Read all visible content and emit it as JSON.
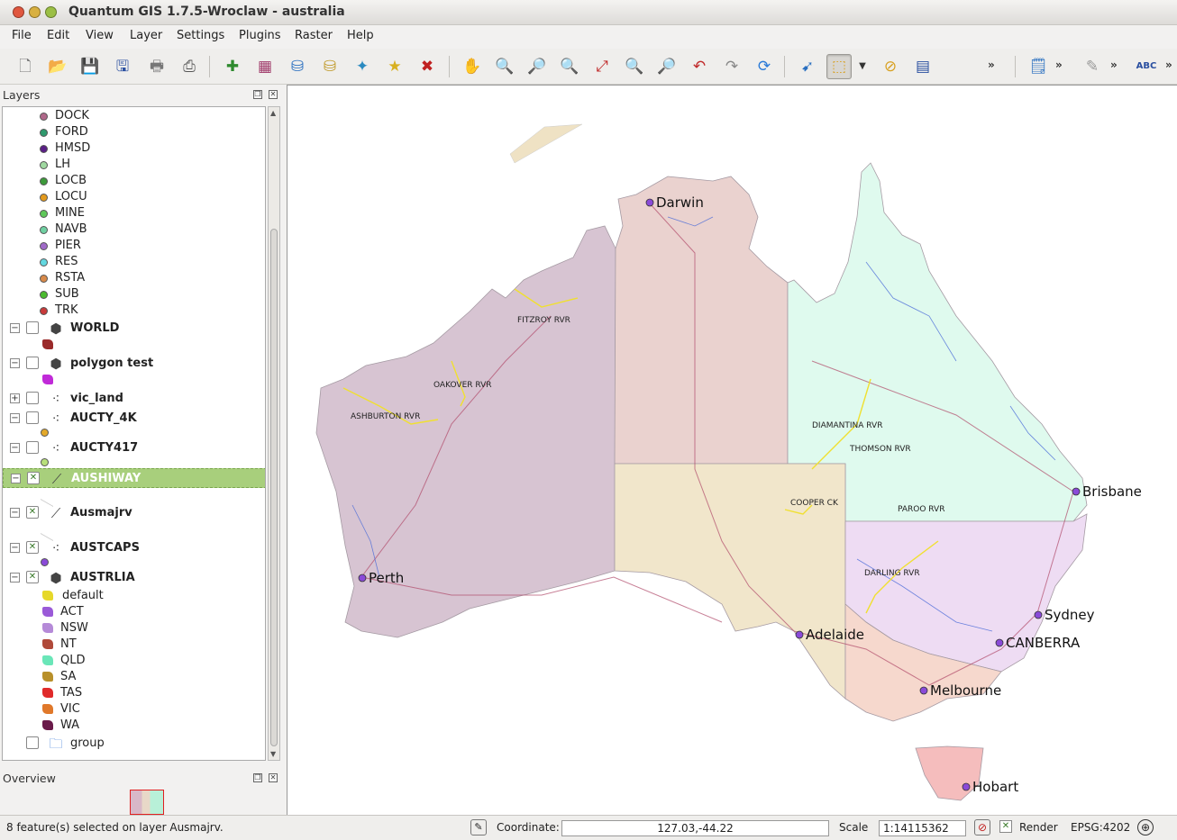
{
  "window": {
    "title": "Quantum GIS 1.7.5-Wroclaw - australia"
  },
  "menu": [
    "File",
    "Edit",
    "View",
    "Layer",
    "Settings",
    "Plugins",
    "Raster",
    "Help"
  ],
  "toolbar": {
    "more": "»"
  },
  "layers_panel": {
    "title": "Layers",
    "classes": [
      {
        "label": "DOCK",
        "color": "#b0688a"
      },
      {
        "label": "FORD",
        "color": "#2f9a6e"
      },
      {
        "label": "HMSD",
        "color": "#5a1f86"
      },
      {
        "label": "LH",
        "color": "#9fd8a0"
      },
      {
        "label": "LOCB",
        "color": "#3c9a3a"
      },
      {
        "label": "LOCU",
        "color": "#e39a1d"
      },
      {
        "label": "MINE",
        "color": "#5fc85a"
      },
      {
        "label": "NAVB",
        "color": "#6fd0a2"
      },
      {
        "label": "PIER",
        "color": "#a06ac8"
      },
      {
        "label": "RES",
        "color": "#63d8e0"
      },
      {
        "label": "RSTA",
        "color": "#d88a4a"
      },
      {
        "label": "SUB",
        "color": "#4bbb2f"
      },
      {
        "label": "TRK",
        "color": "#c83a3a"
      }
    ],
    "layers": {
      "world": "WORLD",
      "polygon_test": "polygon test",
      "vic_land": "vic_land",
      "aucty_4k": "AUCTY_4K",
      "aucty417": "AUCTY417",
      "aushiway": "AUSHIWAY",
      "ausmajrv": "Ausmajrv",
      "austcaps": "AUSTCAPS",
      "austrlia": "AUSTRLIA",
      "group": "group"
    },
    "austrlia_classes": [
      {
        "label": "default",
        "color": "#e6d82a"
      },
      {
        "label": "ACT",
        "color": "#9a5ad8"
      },
      {
        "label": "NSW",
        "color": "#b58ad8"
      },
      {
        "label": "NT",
        "color": "#b04a3a"
      },
      {
        "label": "QLD",
        "color": "#6ae6b8"
      },
      {
        "label": "SA",
        "color": "#b8902a"
      },
      {
        "label": "TAS",
        "color": "#e02a2a"
      },
      {
        "label": "VIC",
        "color": "#e0782a"
      },
      {
        "label": "WA",
        "color": "#6a1a4a"
      }
    ]
  },
  "overview_panel": {
    "title": "Overview"
  },
  "map": {
    "cities": [
      "Darwin",
      "Brisbane",
      "Perth",
      "Sydney",
      "Adelaide",
      "CANBERRA",
      "Melbourne",
      "Hobart"
    ],
    "rivers": [
      "FITZROY RVR",
      "OAKOVER RVR",
      "ASHBURTON RVR",
      "DIAMANTINA RVR",
      "THOMSON RVR",
      "COOPER CK",
      "PAROO RVR",
      "DARLING RVR"
    ]
  },
  "status": {
    "message": "8 feature(s) selected on layer Ausmajrv.",
    "coordinate_label": "Coordinate:",
    "coordinate_value": "127.03,-44.22",
    "scale_label": "Scale",
    "scale_value": "1:14115362",
    "render_label": "Render",
    "crs": "EPSG:4202"
  }
}
